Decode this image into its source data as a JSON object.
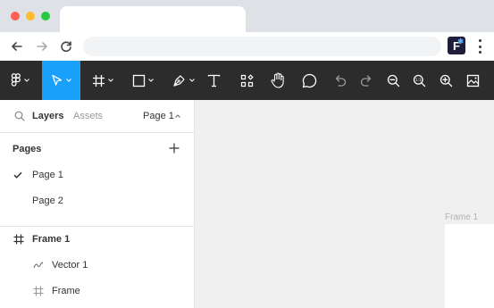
{
  "toolbar": {
    "tools": [
      {
        "name": "figma-menu",
        "icon": "figma-logo-icon"
      },
      {
        "name": "move",
        "icon": "cursor-icon",
        "active": true
      },
      {
        "name": "frame",
        "icon": "hash-icon"
      },
      {
        "name": "shape",
        "icon": "rectangle-icon"
      },
      {
        "name": "pen",
        "icon": "pen-icon"
      },
      {
        "name": "text",
        "icon": "text-icon"
      },
      {
        "name": "resources",
        "icon": "components-icon"
      },
      {
        "name": "hand",
        "icon": "hand-icon"
      },
      {
        "name": "comment",
        "icon": "comment-icon"
      },
      {
        "name": "undo",
        "icon": "undo-icon"
      },
      {
        "name": "redo",
        "icon": "redo-icon"
      },
      {
        "name": "zoom-out",
        "icon": "zoom-out-icon"
      },
      {
        "name": "zoom-fit",
        "icon": "zoom-fit-icon"
      },
      {
        "name": "zoom-in",
        "icon": "zoom-in-icon"
      },
      {
        "name": "image",
        "icon": "image-icon"
      }
    ],
    "accent": "#18a0fb",
    "background": "#2c2c2c"
  },
  "browser": {
    "extension_label": "F"
  },
  "panel": {
    "tabs": {
      "layers": "Layers",
      "assets": "Assets"
    },
    "current_page": "Page 1",
    "pages_title": "Pages",
    "pages": [
      {
        "label": "Page 1",
        "selected": true
      },
      {
        "label": "Page 2",
        "selected": false
      }
    ],
    "layers": [
      {
        "label": "Frame 1",
        "icon": "hash-icon",
        "level": 0
      },
      {
        "label": "Vector 1",
        "icon": "vector-icon",
        "level": 1
      },
      {
        "label": "Frame",
        "icon": "hash-icon",
        "level": 1
      }
    ]
  },
  "canvas": {
    "frame_label": "Frame 1"
  }
}
